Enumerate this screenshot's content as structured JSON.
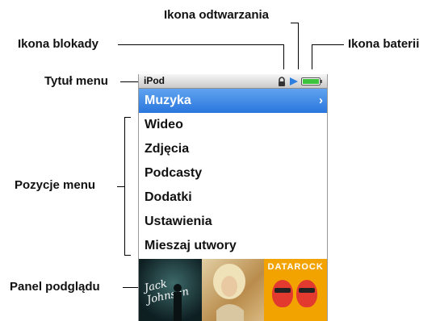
{
  "callouts": {
    "playback_icon": "Ikona odtwarzania",
    "lock_icon": "Ikona blokady",
    "battery_icon": "Ikona baterii",
    "menu_title": "Tytuł menu",
    "menu_items": "Pozycje menu",
    "preview_panel": "Panel podglądu"
  },
  "screen": {
    "title": "iPod",
    "menu": [
      {
        "label": "Muzyka",
        "selected": true,
        "chevron": "›"
      },
      {
        "label": "Wideo"
      },
      {
        "label": "Zdjęcia"
      },
      {
        "label": "Podcasty"
      },
      {
        "label": "Dodatki"
      },
      {
        "label": "Ustawienia"
      },
      {
        "label": "Mieszaj utwory"
      }
    ],
    "preview": {
      "art1_text": "Jack Johnson",
      "art3_text": "DATAROCK"
    }
  },
  "colors": {
    "selection": "#3b8ae6",
    "battery": "#3cc43c",
    "play": "#2a7fe0"
  }
}
